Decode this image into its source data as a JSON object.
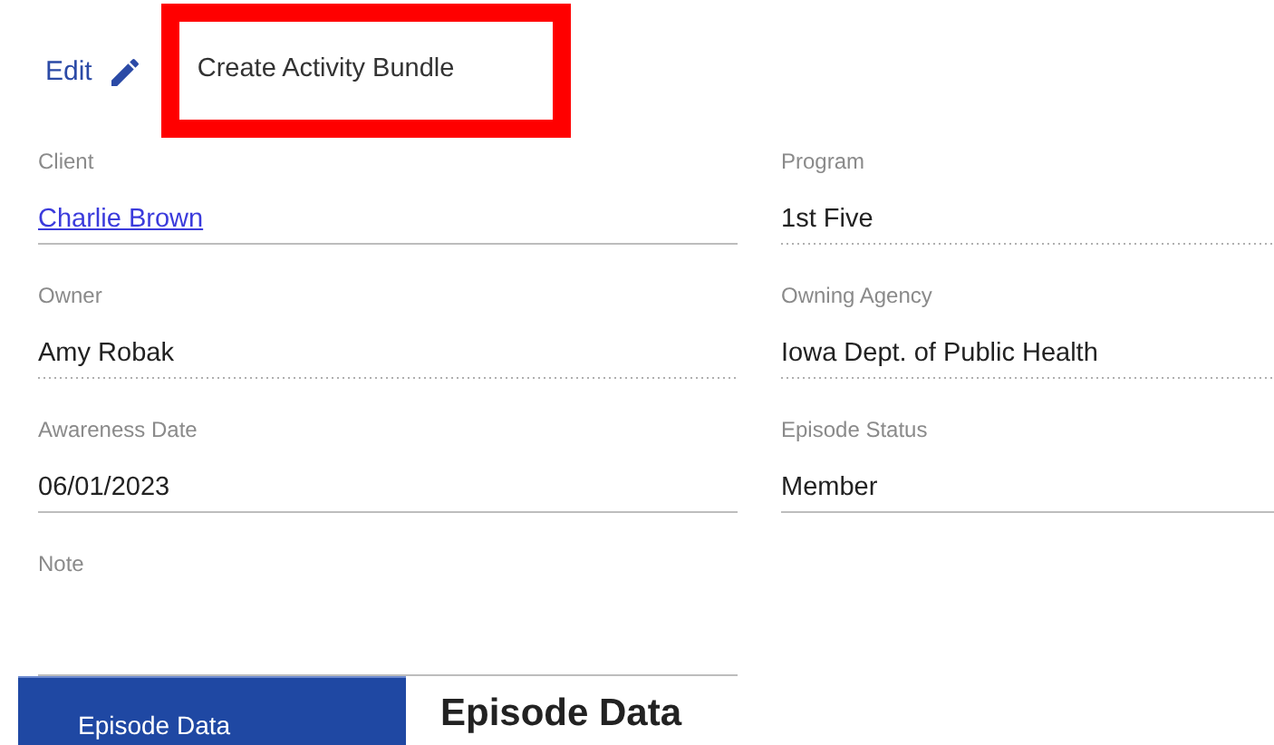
{
  "actions": [
    {
      "kind": "edit",
      "label": "Edit",
      "highlighted": false
    },
    {
      "kind": "plain",
      "label": "Create Activity Bundle",
      "highlighted": true
    }
  ],
  "fields": [
    {
      "label": "Client",
      "value": "Charlie Brown",
      "link": true,
      "disabled": false
    },
    {
      "label": "Program",
      "value": "1st Five",
      "link": false,
      "disabled": true
    },
    {
      "label": "Owner",
      "value": "Amy Robak",
      "link": false,
      "disabled": true
    },
    {
      "label": "Owning Agency",
      "value": "Iowa Dept. of Public Health",
      "link": false,
      "disabled": true
    },
    {
      "label": "Awareness Date",
      "value": "06/01/2023",
      "link": false,
      "disabled": false
    },
    {
      "label": "Episode Status",
      "value": "Member",
      "link": false,
      "disabled": false
    },
    {
      "label": "Note",
      "disabled": false
    }
  ],
  "side_nav": [
    {
      "label": "Episode Data",
      "selected": true
    }
  ],
  "section_title": "Episode Data"
}
